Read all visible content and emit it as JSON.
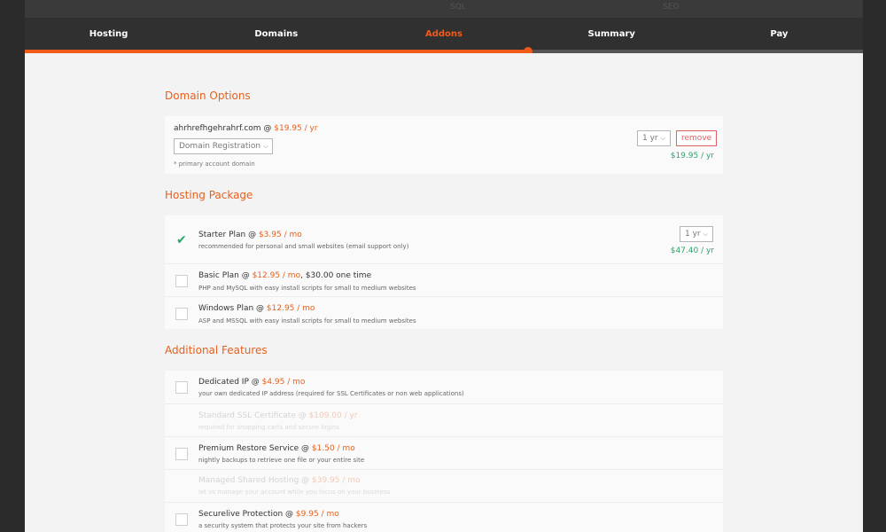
{
  "top_strip": {
    "left_text": "SQL",
    "right_text": "SEO"
  },
  "nav": {
    "items": [
      {
        "label": "Hosting",
        "active": false
      },
      {
        "label": "Domains",
        "active": false
      },
      {
        "label": "Addons",
        "active": true
      },
      {
        "label": "Summary",
        "active": false
      },
      {
        "label": "Pay",
        "active": false
      }
    ],
    "progress_fraction": 0.6
  },
  "colors": {
    "accent": "#f05a1a",
    "green": "#2ea56b",
    "remove": "#e06060"
  },
  "domain_options": {
    "title": "Domain Options",
    "domain": "ahrhrefhgehrahrf.com",
    "at": " @ ",
    "price": "$19.95 / yr",
    "registration_select": "Domain Registration",
    "note": "* primary account domain",
    "term_select": "1 yr",
    "remove_label": "remove",
    "total": "$19.95 / yr"
  },
  "hosting_package": {
    "title": "Hosting Package",
    "plans": [
      {
        "name": "Starter Plan @ ",
        "price": "$3.95 / mo",
        "extra": "",
        "desc": "recommended for personal and small websites (email support only)",
        "checked": true,
        "term": "1 yr",
        "total": "$47.40 / yr"
      },
      {
        "name": "Basic Plan @ ",
        "price": "$12.95 / mo",
        "extra": ", $30.00 one time",
        "desc": "PHP and MySQL with easy install scripts for small to medium websites",
        "checked": false
      },
      {
        "name": "Windows Plan @ ",
        "price": "$12.95 / mo",
        "extra": "",
        "desc": "ASP and MSSQL with easy install scripts for small to medium websites",
        "checked": false
      }
    ]
  },
  "additional_features": {
    "title": "Additional Features",
    "items": [
      {
        "name": "Dedicated IP @ ",
        "price": "$4.95 / mo",
        "desc": "your own dedicated IP address (required for SSL Certificates or non web applications)",
        "disabled": false
      },
      {
        "name": "Standard SSL Certificate @ ",
        "price": "$109.00 / yr",
        "desc": "required for shopping carts and secure logins",
        "disabled": true
      },
      {
        "name": "Premium Restore Service @ ",
        "price": "$1.50 / mo",
        "desc": "nightly backups to retrieve one file or your entire site",
        "disabled": false
      },
      {
        "name": "Managed Shared Hosting @ ",
        "price": "$39.95 / mo",
        "desc": "let us manage your account while you focus on your business",
        "disabled": true
      },
      {
        "name": "Securelive Protection @ ",
        "price": "$9.95 / mo",
        "desc": "a security system that protects your site from hackers",
        "disabled": false
      }
    ]
  }
}
